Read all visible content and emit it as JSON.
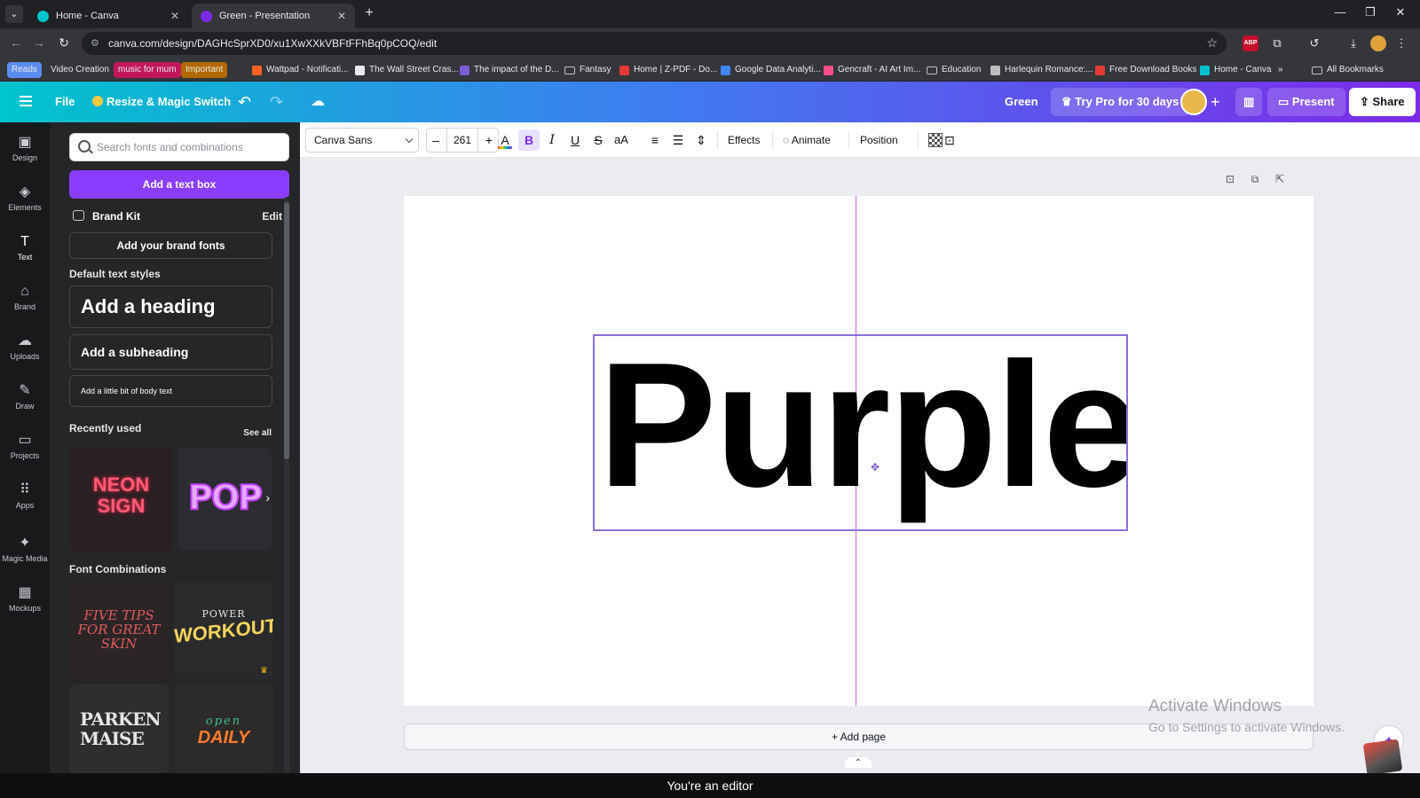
{
  "browser": {
    "tabs": [
      {
        "title": "Home - Canva"
      },
      {
        "title": "Green - Presentation"
      }
    ],
    "url": "canva.com/design/DAGHcSprXD0/xu1XwXXkVBFtFFhBq0pCOQ/edit",
    "bookmarks": [
      {
        "label": "Reads",
        "color": "#5b8def"
      },
      {
        "label": "Video Creation",
        "color": ""
      },
      {
        "label": "music for mum",
        "color": "#c2185b"
      },
      {
        "label": "Important",
        "color": "#b26a00"
      },
      {
        "label": "Wattpad - Notificati...",
        "color": "#ff6122"
      },
      {
        "label": "The Wall Street Cras...",
        "color": "#e8eaed"
      },
      {
        "label": "The impact of the D...",
        "color": "#7b5cd6"
      },
      {
        "label": "Fantasy",
        "color": "folder"
      },
      {
        "label": "Home | Z-PDF - Do...",
        "color": "#e53935"
      },
      {
        "label": "Google Data Analyti...",
        "color": "#4285f4"
      },
      {
        "label": "Gencraft - AI Art Im...",
        "color": "#ff4f8b"
      },
      {
        "label": "Education",
        "color": "folder"
      },
      {
        "label": "Harlequin Romance:...",
        "color": "#bdbdbd"
      },
      {
        "label": "Free Download Books",
        "color": "#e53935"
      },
      {
        "label": "Home - Canva",
        "color": "#00c4cc"
      },
      {
        "label": "All Bookmarks",
        "color": "folder"
      }
    ]
  },
  "header": {
    "file": "File",
    "magic_switch": "Resize & Magic Switch",
    "design_name": "Green",
    "try_pro": "Try Pro for 30 days",
    "present": "Present",
    "share": "Share"
  },
  "rail": [
    {
      "label": "Design",
      "icon": "design-icon",
      "glyph": "▣"
    },
    {
      "label": "Elements",
      "icon": "elements-icon",
      "glyph": "◈"
    },
    {
      "label": "Text",
      "icon": "text-icon",
      "glyph": "T"
    },
    {
      "label": "Brand",
      "icon": "brand-icon",
      "glyph": "⌂"
    },
    {
      "label": "Uploads",
      "icon": "uploads-icon",
      "glyph": "☁"
    },
    {
      "label": "Draw",
      "icon": "draw-icon",
      "glyph": "✎"
    },
    {
      "label": "Projects",
      "icon": "projects-icon",
      "glyph": "▭"
    },
    {
      "label": "Apps",
      "icon": "apps-icon",
      "glyph": "⠿"
    },
    {
      "label": "Magic Media",
      "icon": "magic-media-icon",
      "glyph": "✦"
    },
    {
      "label": "Mockups",
      "icon": "mockups-icon",
      "glyph": "▦"
    }
  ],
  "text_panel": {
    "search_placeholder": "Search fonts and combinations",
    "add_text_box": "Add a text box",
    "brand_kit": "Brand Kit",
    "brand_kit_edit": "Edit",
    "add_brand_fonts": "Add your brand fonts",
    "default_styles_title": "Default text styles",
    "heading": "Add a heading",
    "subheading": "Add a subheading",
    "body": "Add a little bit of body text",
    "recently_used": "Recently used",
    "see_all": "See all",
    "neon_line1": "NEON",
    "neon_line2": "SIGN",
    "pop_text": "POP",
    "font_combinations": "Font Combinations",
    "fc1_line1": "FIVE TIPS",
    "fc1_line2": "FOR GREAT",
    "fc1_line3": "SKIN",
    "fc2_line1": "POWER",
    "fc2_line2": "WORKOUT",
    "fc3_line1": "PARKEN",
    "fc3_line2": "MAISE",
    "fc4_line1": "open",
    "fc4_line2": "DAILY"
  },
  "toolbar": {
    "font": "Canva Sans",
    "font_size": "261",
    "effects": "Effects",
    "animate": "Animate",
    "position": "Position"
  },
  "canvas": {
    "text": "Purple",
    "add_page": "+ Add page",
    "activate_title": "Activate Windows",
    "activate_sub": "Go to Settings to activate Windows."
  },
  "status": "You're an editor",
  "colors": {
    "accent": "#8b3dff",
    "selection": "#8b6fd6",
    "guide": "#c56ad6"
  }
}
